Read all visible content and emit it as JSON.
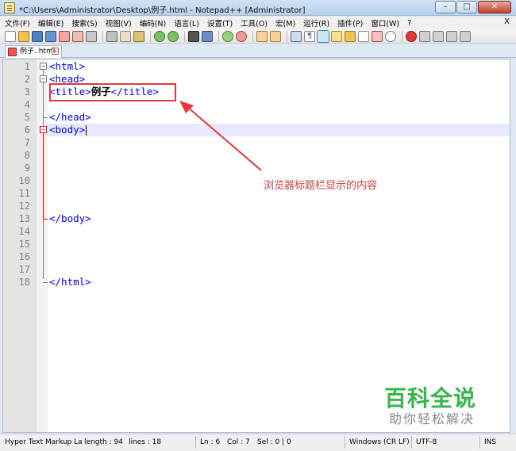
{
  "window": {
    "title": "*C:\\Users\\Administrator\\Desktop\\例子.html - Notepad++ [Administrator]",
    "btn_minimize": "–",
    "btn_maximize": "□",
    "btn_close": "✕"
  },
  "menu": {
    "items": [
      "文件(F)",
      "编辑(E)",
      "搜索(S)",
      "视图(V)",
      "编码(N)",
      "语言(L)",
      "设置(T)",
      "工具(O)",
      "宏(M)",
      "运行(R)",
      "插件(P)",
      "窗口(W)",
      "?"
    ],
    "close": "X"
  },
  "tab": {
    "label": "例子. html",
    "close": "×"
  },
  "editor": {
    "lines": [
      {
        "num": "1",
        "code": "<html>"
      },
      {
        "num": "2",
        "code": "<head>"
      },
      {
        "num": "3",
        "open": "<title>",
        "text": "例子",
        "close": "</title>"
      },
      {
        "num": "4",
        "code": ""
      },
      {
        "num": "5",
        "code": "</head>"
      },
      {
        "num": "6",
        "code": "<body>"
      },
      {
        "num": "7",
        "code": ""
      },
      {
        "num": "8",
        "code": ""
      },
      {
        "num": "9",
        "code": ""
      },
      {
        "num": "10",
        "code": ""
      },
      {
        "num": "11",
        "code": ""
      },
      {
        "num": "12",
        "code": ""
      },
      {
        "num": "13",
        "code": "</body>"
      },
      {
        "num": "14",
        "code": ""
      },
      {
        "num": "15",
        "code": ""
      },
      {
        "num": "16",
        "code": ""
      },
      {
        "num": "17",
        "code": ""
      },
      {
        "num": "18",
        "code": "</html>"
      }
    ]
  },
  "annotation": {
    "text": "浏览器标题栏显示的内容",
    "color": "#e03a3a"
  },
  "watermark": {
    "main": "百科全说",
    "sub": "助你轻松解决",
    "color": "#39b54a"
  },
  "status": {
    "lang": "Hyper Text Markup La",
    "length": "length : 94",
    "lines": "lines : 18",
    "ln": "Ln : 6",
    "col": "Col : 7",
    "sel": "Sel : 0 | 0",
    "eol": "Windows (CR LF)",
    "enc": "UTF-8",
    "mode": "INS"
  }
}
